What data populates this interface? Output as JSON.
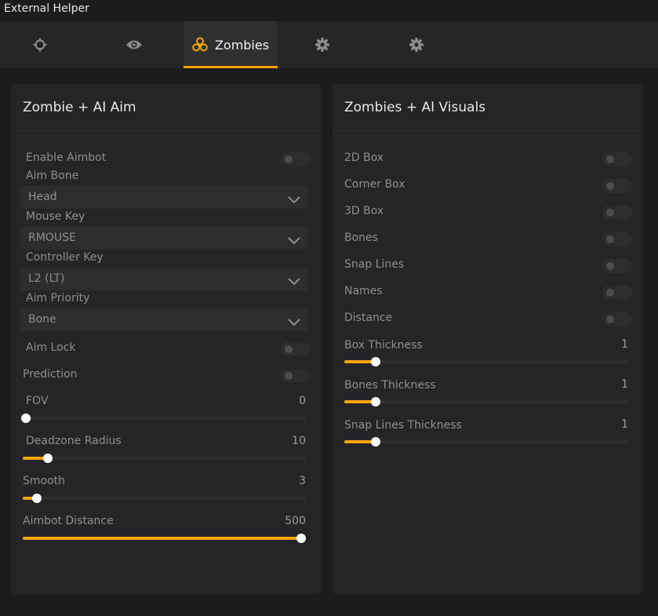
{
  "window": {
    "title": "External Helper"
  },
  "tabs": [
    {
      "icon": "crosshair-icon",
      "label": ""
    },
    {
      "icon": "eye-icon",
      "label": ""
    },
    {
      "icon": "biohazard-icon",
      "label": "Zombies"
    },
    {
      "icon": "gear-icon",
      "label": ""
    },
    {
      "icon": "gear-icon",
      "label": ""
    }
  ],
  "colors": {
    "accent": "#f5a20a",
    "panel": "#242526",
    "background": "#1b1c1d"
  },
  "aim_panel": {
    "title": "Zombie + AI Aim",
    "enable_aimbot": {
      "label": "Enable Aimbot",
      "on": false
    },
    "aim_bone": {
      "label": "Aim Bone",
      "value": "Head"
    },
    "mouse_key": {
      "label": "Mouse Key",
      "value": "RMOUSE"
    },
    "controller_key": {
      "label": "Controller Key",
      "value": "L2 (LT)"
    },
    "aim_priority": {
      "label": "Aim Priority",
      "value": "Bone"
    },
    "aim_lock": {
      "label": "Aim Lock",
      "on": false
    },
    "prediction": {
      "label": "Prediction",
      "on": false
    },
    "fov": {
      "label": "FOV",
      "value": "0",
      "fraction": 0.01
    },
    "deadzone": {
      "label": "Deadzone Radius",
      "value": "10",
      "fraction": 0.09
    },
    "smooth": {
      "label": "Smooth",
      "value": "3",
      "fraction": 0.05
    },
    "aimbot_distance": {
      "label": "Aimbot Distance",
      "value": "500",
      "fraction": 1.0
    }
  },
  "visuals_panel": {
    "title": "Zombies + AI Visuals",
    "toggles": [
      {
        "label": "2D Box",
        "on": false
      },
      {
        "label": "Corner Box",
        "on": false
      },
      {
        "label": "3D Box",
        "on": false
      },
      {
        "label": "Bones",
        "on": false
      },
      {
        "label": "Snap Lines",
        "on": false
      },
      {
        "label": "Names",
        "on": false
      },
      {
        "label": "Distance",
        "on": false
      }
    ],
    "sliders": [
      {
        "label": "Box Thickness",
        "value": "1",
        "fraction": 0.11
      },
      {
        "label": "Bones Thickness",
        "value": "1",
        "fraction": 0.11
      },
      {
        "label": "Snap Lines Thickness",
        "value": "1",
        "fraction": 0.11
      }
    ]
  }
}
